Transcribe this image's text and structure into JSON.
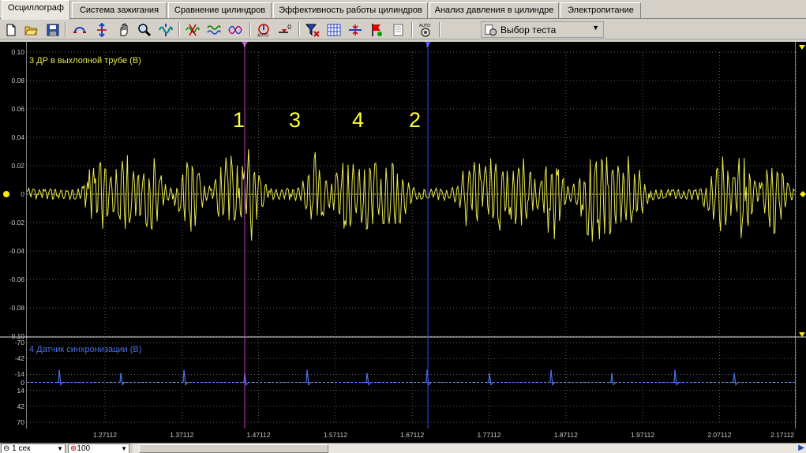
{
  "tabs": [
    {
      "label": "Осциллограф"
    },
    {
      "label": "Система зажигания"
    },
    {
      "label": "Сравнение цилиндров"
    },
    {
      "label": "Эффективность работы цилиндров"
    },
    {
      "label": "Анализ давления в цилиндре"
    },
    {
      "label": "Электропитание"
    }
  ],
  "toolbar": {
    "icons": [
      "new-file-icon",
      "open-folder-icon",
      "save-icon",
      "zoom-horizontal-icon",
      "zoom-vertical-icon",
      "hand-pan-icon",
      "magnifier-icon",
      "fit-signal-icon",
      "cursor-measure-icon",
      "channels-overlay-icon",
      "channels-split-icon",
      "auto-trigger-icon",
      "zero-level-icon",
      "filter-icon",
      "grid-table-icon",
      "divider-icon",
      "flag-icon",
      "page-icon",
      "auto-settings-icon"
    ],
    "test_select": "Выбор теста",
    "auto_label": "AUTO"
  },
  "colors": {
    "channel1": "#e8e850",
    "channel2": "#4a70e8",
    "cursor1": "#c040c0",
    "cursor2": "#3040ff",
    "grid": "#808080"
  },
  "channel1": {
    "title": "3 ДР в выхлопной трубе (В)",
    "yticks": [
      "0.10",
      "0.08",
      "0.06",
      "0.04",
      "0.02",
      "0",
      "-0.02",
      "-0.04",
      "-0.06",
      "-0.08",
      "-0.10"
    ]
  },
  "channel2": {
    "title": "4 Датчик синхронизации (В)",
    "yticks": [
      "-70",
      "-42",
      "-14",
      "0",
      "14",
      "42",
      "70"
    ]
  },
  "cylinder_markers": [
    "1",
    "3",
    "4",
    "2"
  ],
  "cursors": {
    "c1_label": "1",
    "c2_label": "2"
  },
  "xticks": [
    "1.27112",
    "1.37112",
    "1.47112",
    "1.57112",
    "1.67112",
    "1.77112",
    "1.87112",
    "1.97112",
    "2.07112",
    "2.17112"
  ],
  "bottom": {
    "timebase": "1 сек",
    "zoom": "100"
  }
}
